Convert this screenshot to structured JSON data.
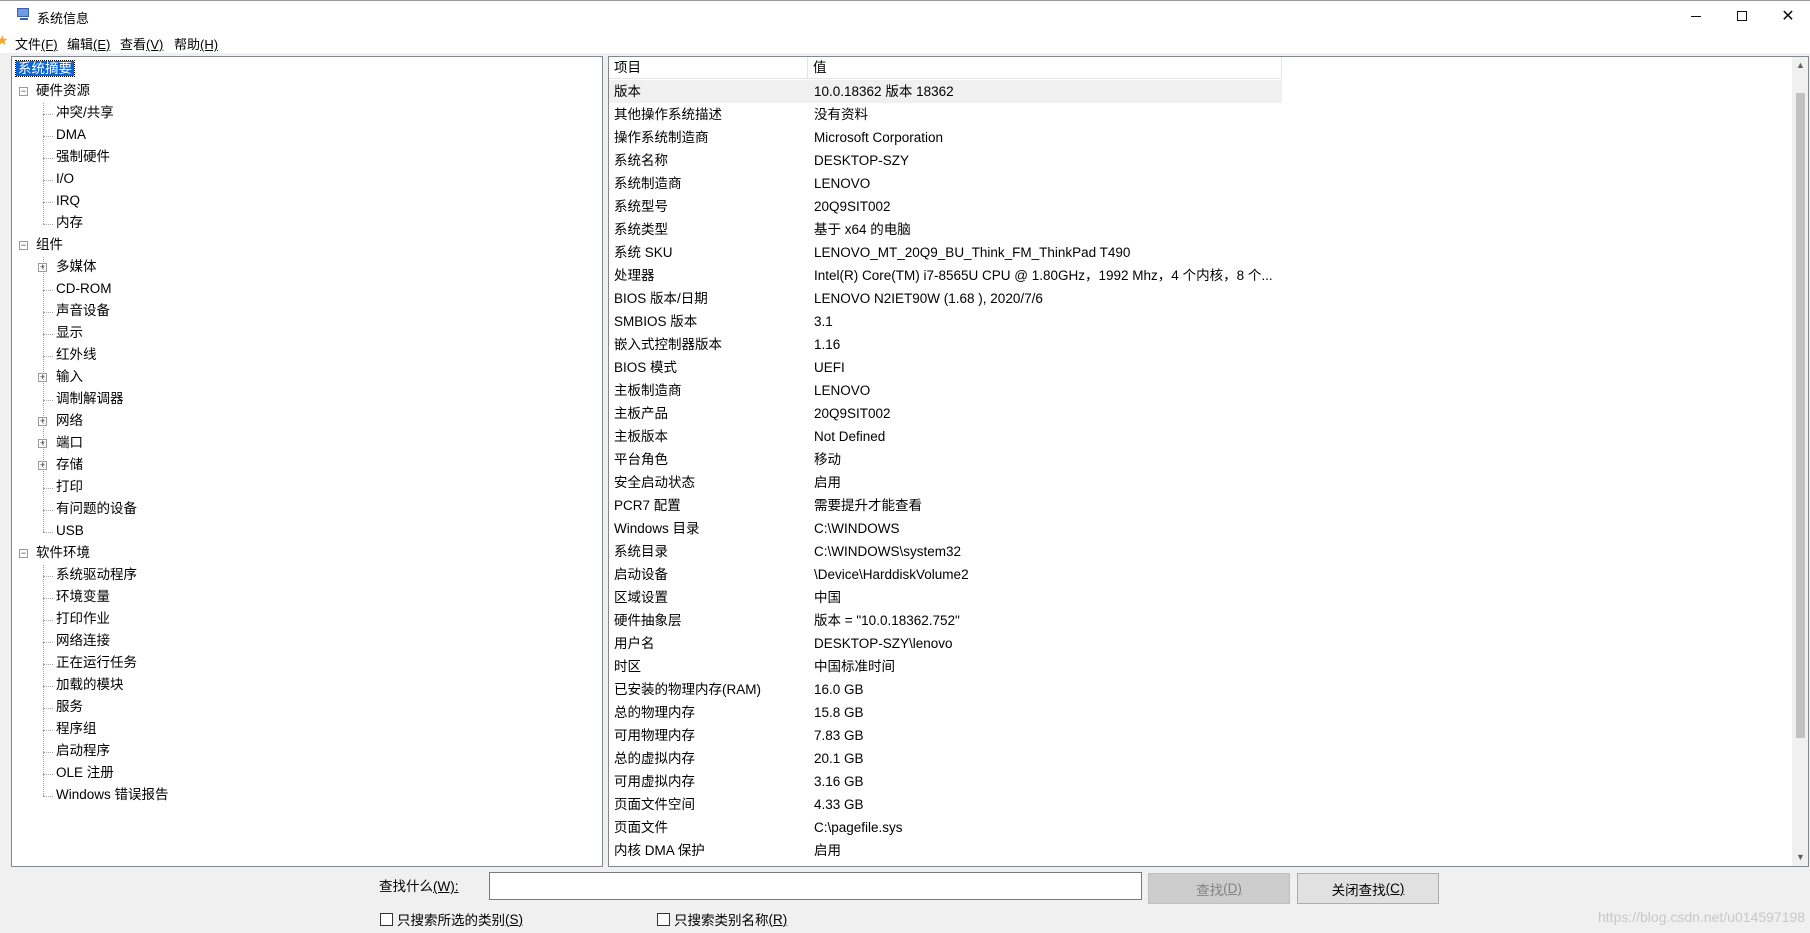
{
  "window": {
    "title": "系统信息",
    "icon": "system-info-icon",
    "controls": [
      "minimize-icon",
      "maximize-icon",
      "close-icon"
    ]
  },
  "menu": [
    {
      "label": "文件",
      "key": "(F)"
    },
    {
      "label": "编辑",
      "key": "(E)"
    },
    {
      "label": "查看",
      "key": "(V)"
    },
    {
      "label": "帮助",
      "key": "(H)"
    }
  ],
  "tree": {
    "root": "系统摘要",
    "hardware": {
      "label": "硬件资源",
      "children": [
        "冲突/共享",
        "DMA",
        "强制硬件",
        "I/O",
        "IRQ",
        "内存"
      ]
    },
    "components": {
      "label": "组件",
      "children": [
        "多媒体",
        "CD-ROM",
        "声音设备",
        "显示",
        "红外线",
        "输入",
        "调制解调器",
        "网络",
        "端口",
        "存储",
        "打印",
        "有问题的设备",
        "USB"
      ]
    },
    "software": {
      "label": "软件环境",
      "children": [
        "系统驱动程序",
        "环境变量",
        "打印作业",
        "网络连接",
        "正在运行任务",
        "加载的模块",
        "服务",
        "程序组",
        "启动程序",
        "OLE 注册",
        "Windows 错误报告"
      ]
    }
  },
  "list": {
    "columns": [
      "项目",
      "值"
    ],
    "rows": [
      [
        "版本",
        "10.0.18362 版本 18362"
      ],
      [
        "其他操作系统描述",
        "没有资料"
      ],
      [
        "操作系统制造商",
        "Microsoft Corporation"
      ],
      [
        "系统名称",
        "DESKTOP-SZY"
      ],
      [
        "系统制造商",
        "LENOVO"
      ],
      [
        "系统型号",
        "20Q9SIT002"
      ],
      [
        "系统类型",
        "基于 x64 的电脑"
      ],
      [
        "系统 SKU",
        "LENOVO_MT_20Q9_BU_Think_FM_ThinkPad T490"
      ],
      [
        "处理器",
        "Intel(R) Core(TM) i7-8565U CPU @ 1.80GHz，1992 Mhz，4 个内核，8 个..."
      ],
      [
        "BIOS 版本/日期",
        "LENOVO N2IET90W (1.68 ), 2020/7/6"
      ],
      [
        "SMBIOS 版本",
        "3.1"
      ],
      [
        "嵌入式控制器版本",
        "1.16"
      ],
      [
        "BIOS 模式",
        "UEFI"
      ],
      [
        "主板制造商",
        "LENOVO"
      ],
      [
        "主板产品",
        "20Q9SIT002"
      ],
      [
        "主板版本",
        "Not Defined"
      ],
      [
        "平台角色",
        "移动"
      ],
      [
        "安全启动状态",
        "启用"
      ],
      [
        "PCR7 配置",
        "需要提升才能查看"
      ],
      [
        "Windows 目录",
        "C:\\WINDOWS"
      ],
      [
        "系统目录",
        "C:\\WINDOWS\\system32"
      ],
      [
        "启动设备",
        "\\Device\\HarddiskVolume2"
      ],
      [
        "区域设置",
        "中国"
      ],
      [
        "硬件抽象层",
        "版本 = \"10.0.18362.752\""
      ],
      [
        "用户名",
        "DESKTOP-SZY\\lenovo"
      ],
      [
        "时区",
        "中国标准时间"
      ],
      [
        "已安装的物理内存(RAM)",
        "16.0 GB"
      ],
      [
        "总的物理内存",
        "15.8 GB"
      ],
      [
        "可用物理内存",
        "7.83 GB"
      ],
      [
        "总的虚拟内存",
        "20.1 GB"
      ],
      [
        "可用虚拟内存",
        "3.16 GB"
      ],
      [
        "页面文件空间",
        "4.33 GB"
      ],
      [
        "页面文件",
        "C:\\pagefile.sys"
      ],
      [
        "内核 DMA 保护",
        "启用"
      ]
    ]
  },
  "find": {
    "label": "查找什么",
    "label_key": "(W):",
    "value": "",
    "find_button": "查找",
    "find_button_key": "(D)",
    "close_button": "关闭查找",
    "close_button_key": "(C)",
    "checkbox_selected": "只搜索所选的类别",
    "checkbox_selected_key": "(S)",
    "checkbox_names": "只搜索类别名称",
    "checkbox_names_key": "(R)"
  },
  "watermark": "https://blog.csdn.net/u014597198"
}
